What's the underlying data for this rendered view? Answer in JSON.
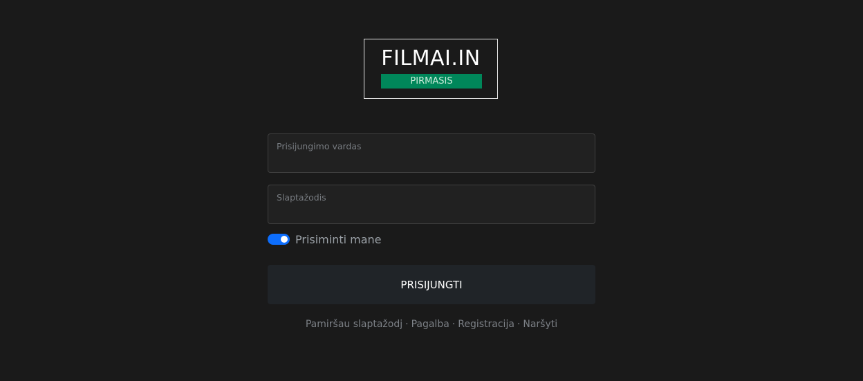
{
  "logo": {
    "title": "FILMAI.IN",
    "subtitle": "PIRMASIS"
  },
  "form": {
    "username": {
      "label": "Prisijungimo vardas",
      "value": ""
    },
    "password": {
      "label": "Slaptažodis",
      "value": ""
    },
    "remember": {
      "label": "Prisiminti mane",
      "checked": true
    },
    "submit_label": "PRISIJUNGTI"
  },
  "links": {
    "forgot": "Pamiršau slaptažodj",
    "help": "Pagalba",
    "register": "Registracija",
    "browse": "Naršyti",
    "separator": "·"
  },
  "colors": {
    "background": "#1a1a1a",
    "accent": "#00875a",
    "toggle": "#0d6efd"
  }
}
